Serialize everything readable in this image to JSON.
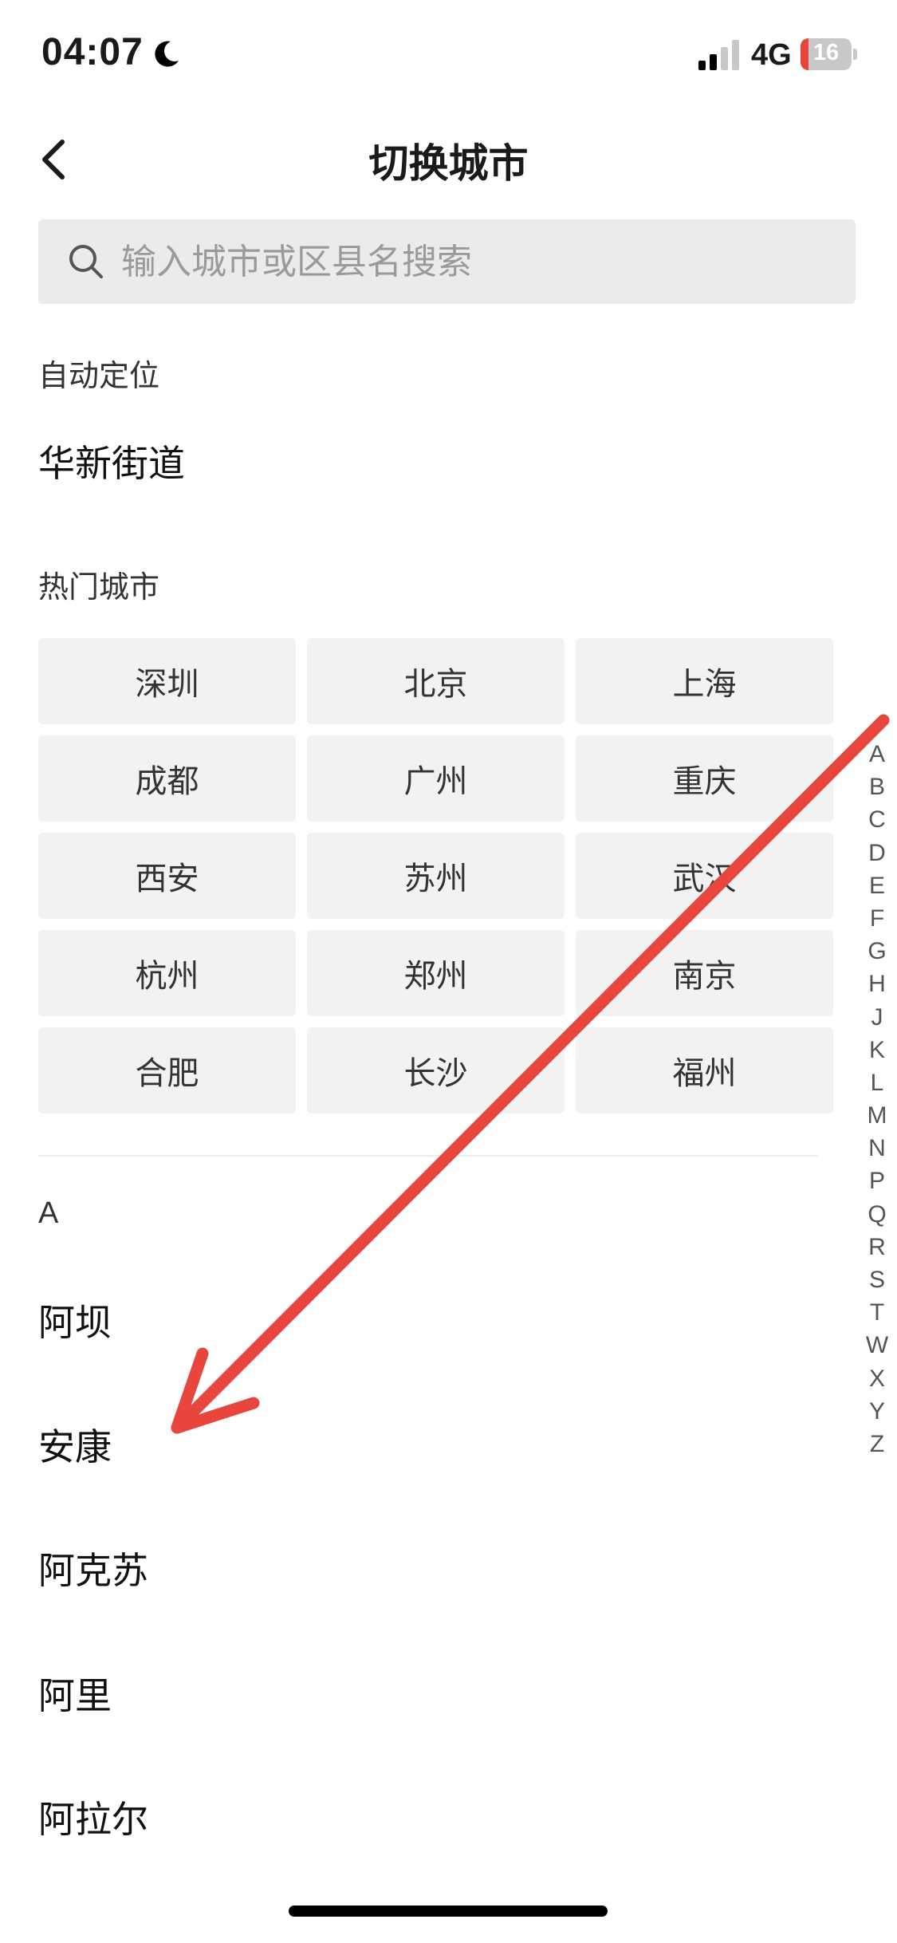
{
  "status_bar": {
    "time": "04:07",
    "network": "4G",
    "battery_percent": "16",
    "battery_level": 0.16,
    "battery_color": "#e5453a"
  },
  "header": {
    "title": "切换城市",
    "back_icon": "chevron-left-icon"
  },
  "search": {
    "placeholder": "输入城市或区县名搜索",
    "value": ""
  },
  "auto_location": {
    "label": "自动定位",
    "city": "华新街道"
  },
  "hot_cities": {
    "label": "热门城市",
    "items": [
      "深圳",
      "北京",
      "上海",
      "成都",
      "广州",
      "重庆",
      "西安",
      "苏州",
      "武汉",
      "杭州",
      "郑州",
      "南京",
      "合肥",
      "长沙",
      "福州"
    ]
  },
  "city_list": {
    "letter": "A",
    "items": [
      "阿坝",
      "安康",
      "阿克苏",
      "阿里",
      "阿拉尔"
    ]
  },
  "index_bar": {
    "letters": [
      "A",
      "B",
      "C",
      "D",
      "E",
      "F",
      "G",
      "H",
      "J",
      "K",
      "L",
      "M",
      "N",
      "P",
      "Q",
      "R",
      "S",
      "T",
      "W",
      "X",
      "Y",
      "Z"
    ]
  },
  "annotation": {
    "color": "#e8453c"
  }
}
